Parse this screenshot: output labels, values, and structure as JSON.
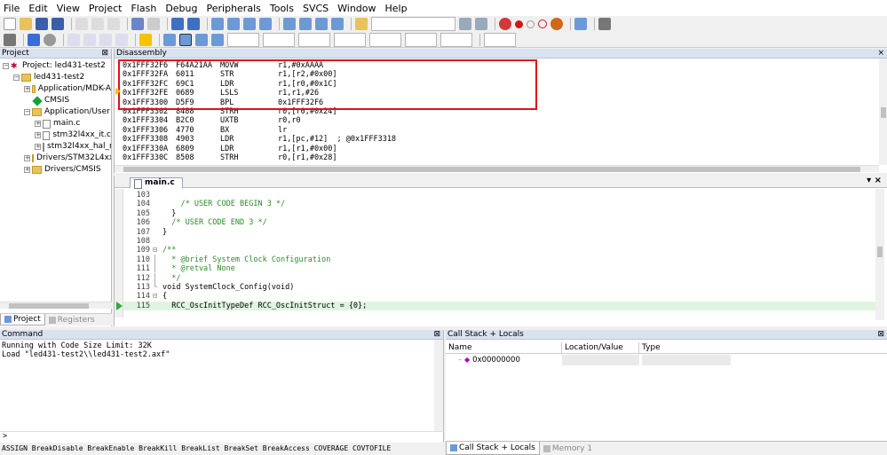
{
  "menu": [
    "File",
    "Edit",
    "View",
    "Project",
    "Flash",
    "Debug",
    "Peripherals",
    "Tools",
    "SVCS",
    "Window",
    "Help"
  ],
  "project_pane": {
    "title": "Project",
    "tree": [
      {
        "label": "Project: led431-test2",
        "level": 0,
        "kind": "root",
        "toggle": "-"
      },
      {
        "label": "led431-test2",
        "level": 1,
        "kind": "folder",
        "toggle": "-"
      },
      {
        "label": "Application/MDK-A",
        "level": 2,
        "kind": "folder",
        "toggle": "+"
      },
      {
        "label": "CMSIS",
        "level": 2,
        "kind": "component",
        "toggle": ""
      },
      {
        "label": "Application/User",
        "level": 2,
        "kind": "folder",
        "toggle": "-"
      },
      {
        "label": "main.c",
        "level": 3,
        "kind": "file",
        "toggle": "+"
      },
      {
        "label": "stm32l4xx_it.c",
        "level": 3,
        "kind": "file",
        "toggle": "+"
      },
      {
        "label": "stm32l4xx_hal_n",
        "level": 3,
        "kind": "file",
        "toggle": "+"
      },
      {
        "label": "Drivers/STM32L4xx_",
        "level": 2,
        "kind": "folder",
        "toggle": "+"
      },
      {
        "label": "Drivers/CMSIS",
        "level": 2,
        "kind": "folder",
        "toggle": "+"
      }
    ],
    "tabs": [
      "Project",
      "Registers"
    ]
  },
  "disassembly": {
    "title": "Disassembly",
    "rows": [
      {
        "addr": "0x1FFF32F6",
        "hex": "F64A21AA",
        "mnem": "MOVW",
        "ops": "r1,#0xAAAA"
      },
      {
        "addr": "0x1FFF32FA",
        "hex": "6011",
        "mnem": "STR",
        "ops": "r1,[r2,#0x00]"
      },
      {
        "addr": "0x1FFF32FC",
        "hex": "69C1",
        "mnem": "LDR",
        "ops": "r1,[r0,#0x1C]"
      },
      {
        "addr": "0x1FFF32FE",
        "hex": "0689",
        "mnem": "LSLS",
        "ops": "r1,r1,#26"
      },
      {
        "addr": "0x1FFF3300",
        "hex": "D5F9",
        "mnem": "BPL",
        "ops": "0x1FFF32F6"
      },
      {
        "addr": "0x1FFF3302",
        "hex": "8488",
        "mnem": "STRH",
        "ops": "r0,[r0,#0x24]"
      },
      {
        "addr": "0x1FFF3304",
        "hex": "B2C0",
        "mnem": "UXTB",
        "ops": "r0,r0"
      },
      {
        "addr": "0x1FFF3306",
        "hex": "4770",
        "mnem": "BX",
        "ops": "lr"
      },
      {
        "addr": "0x1FFF3308",
        "hex": "4903",
        "mnem": "LDR",
        "ops": "r1,[pc,#12]  ; @0x1FFF3318"
      },
      {
        "addr": "0x1FFF330A",
        "hex": "6809",
        "mnem": "LDR",
        "ops": "r1,[r1,#0x00]"
      },
      {
        "addr": "0x1FFF330C",
        "hex": "8508",
        "mnem": "STRH",
        "ops": "r0,[r1,#0x28]"
      }
    ]
  },
  "editor": {
    "tab": "main.c",
    "lines": [
      {
        "n": "103",
        "fold": "",
        "text": ""
      },
      {
        "n": "104",
        "fold": "",
        "text": "    /* USER CODE BEGIN 3 */",
        "cls": "comment"
      },
      {
        "n": "105",
        "fold": "",
        "text": "  }"
      },
      {
        "n": "106",
        "fold": "",
        "text": "  /* USER CODE END 3 */",
        "cls": "comment"
      },
      {
        "n": "107",
        "fold": "",
        "text": "}"
      },
      {
        "n": "108",
        "fold": "",
        "text": ""
      },
      {
        "n": "109",
        "fold": "⊟",
        "text": "/**",
        "cls": "comment"
      },
      {
        "n": "110",
        "fold": "",
        "text": "  * @brief System Clock Configuration",
        "cls": "comment"
      },
      {
        "n": "111",
        "fold": "",
        "text": "  * @retval None",
        "cls": "comment"
      },
      {
        "n": "112",
        "fold": "",
        "text": "  */",
        "cls": "comment"
      },
      {
        "n": "113",
        "fold": "",
        "text": "void SystemClock_Config(void)"
      },
      {
        "n": "114",
        "fold": "⊟",
        "text": "{"
      },
      {
        "n": "115",
        "fold": "",
        "text": "  RCC_OscInitTypeDef RCC_OscInitStruct = {0};",
        "current": true
      }
    ]
  },
  "command": {
    "title": "Command",
    "lines": [
      "Running with Code Size Limit: 32K",
      "Load \"led431-test2\\\\led431-test2.axf\""
    ],
    "prompt": ">",
    "hints": "ASSIGN BreakDisable BreakEnable BreakKill BreakList BreakSet BreakAccess COVERAGE COVTOFILE"
  },
  "callstack": {
    "title": "Call Stack + Locals",
    "columns": [
      "Name",
      "Location/Value",
      "Type"
    ],
    "rows": [
      {
        "name": "0x00000000",
        "location": "",
        "type": ""
      }
    ],
    "tabs": [
      "Call Stack + Locals",
      "Memory 1"
    ]
  },
  "colors": {
    "highlight_box": "#e4101a",
    "pc_arrow": "#2cab3b",
    "comment": "#2c8a2c"
  }
}
